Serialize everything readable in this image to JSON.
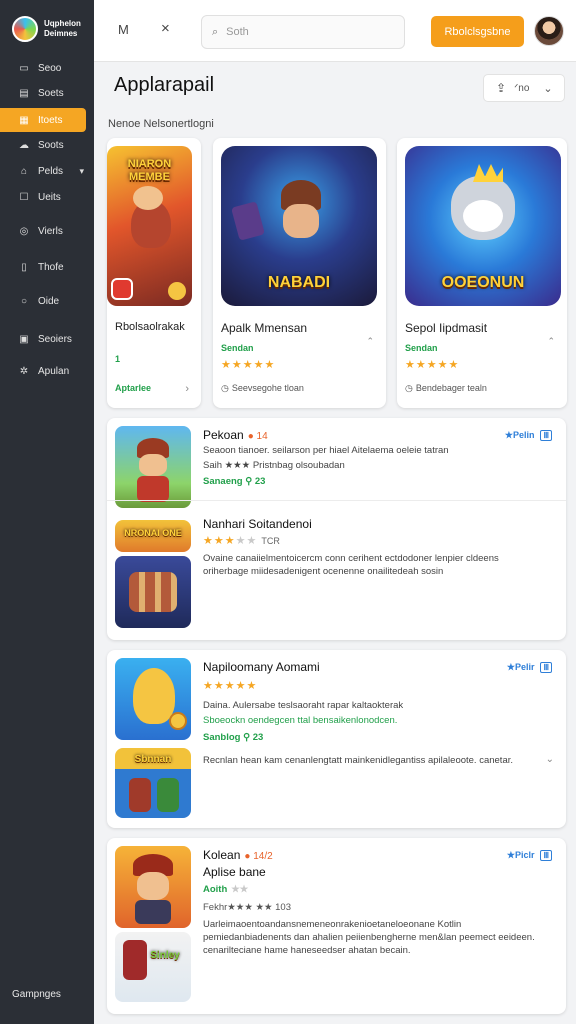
{
  "brand": {
    "line1": "Uqphelon",
    "line2": "Deimnes"
  },
  "sidebar": {
    "items": [
      {
        "label": "Seoo",
        "icon": "calendar-icon"
      },
      {
        "label": "Soets",
        "icon": "book-icon"
      },
      {
        "label": "Itoets",
        "icon": "grid-icon",
        "active": true
      },
      {
        "label": "Soots",
        "icon": "cloud-icon"
      },
      {
        "label": "Pelds",
        "icon": "home-icon",
        "caret": true
      },
      {
        "label": "Ueits",
        "icon": "square-icon"
      },
      {
        "label": "Vierls",
        "icon": "target-icon"
      },
      {
        "label": "Thofe",
        "icon": "phone-icon"
      },
      {
        "label": "Oide",
        "icon": "circle-icon"
      },
      {
        "label": "Seoiers",
        "icon": "folder-icon"
      },
      {
        "label": "Apulan",
        "icon": "gear-icon"
      }
    ],
    "footer": "Gampnges"
  },
  "topbar": {
    "menu_icon": "M",
    "close_icon": "×",
    "search_placeholder": "Soth",
    "cta_label": "Rbolclsgsbne"
  },
  "page": {
    "title": "Applarapail",
    "view_label": "ᐟno",
    "section_label": "Nenoe  Nelsonertlogni"
  },
  "featured": [
    {
      "art_text": "NIARON MEMBE",
      "title": "Rbolsaolrakak",
      "sub": "1",
      "stars": "",
      "note": "Aptarlee",
      "note_icon": "›"
    },
    {
      "art_text": "NABADI",
      "title": "Apalk  Mmensan",
      "sub": "Sendan",
      "stars": "★★★★★",
      "note": "Seevsegohe tloan"
    },
    {
      "art_text": "OOEONUN",
      "title": "Sepol  Iipdmasit",
      "sub": "Sendan",
      "stars": "★★★★★",
      "note": "Bendebager tealn"
    }
  ],
  "list": [
    {
      "title": "Pekoan",
      "title_badge": "● 14",
      "text1": "Seaoon tianoer. seilarson per hiael Aitelaema oeleie tatran",
      "text2": "Saih ★★★  Pristnbag olsoubadan",
      "green": "Sanaeng ⚲ 23",
      "badge": "★Pelin",
      "badge_box": "Ⅲ",
      "sub_title": "Nanhari Soitandenoi",
      "sub_stars": "★★★",
      "sub_grey": "★★",
      "sub_count": "TCR",
      "sub_text": "Ovaine canaiielmentoicercm conn cerihent ectdodoner lenpier cldeens oriherbage miidesadenigent ocenenne onailitedeah sosin"
    },
    {
      "title": "Napiloomany Aomami",
      "stars": "★★★★★",
      "text1": "Daina. Aulersabe teslsaoraht rapar kaltaokterak",
      "text2": "Sboeockn  oendegcen ttal bensaikenlonodcen.",
      "green": "Sanblog ⚲ 23",
      "badge": "★Pelir",
      "badge_box": "Ⅲ",
      "sub_text": "Recnlan hean kam cenanlengtatt mainkenidlegantiss apilaleoote. canetar."
    },
    {
      "title": "Kolean",
      "title_badge": "● 14/2",
      "title2": "Aplise bane",
      "green": "Aoith",
      "green_stars": "★★",
      "text2": "Fekhr★★★ ★★ 103",
      "badge": "★Piclr",
      "badge_box": "Ⅲ",
      "sub_text": "Uarleimaoentoandansnemeneonrakenioetaneloeonane Kotlin pemiedanbiadenents dan ahalien peiienbengherne men&lan peemect eeideen. cenarilteciane hame haneseedser ahatan becain."
    }
  ]
}
